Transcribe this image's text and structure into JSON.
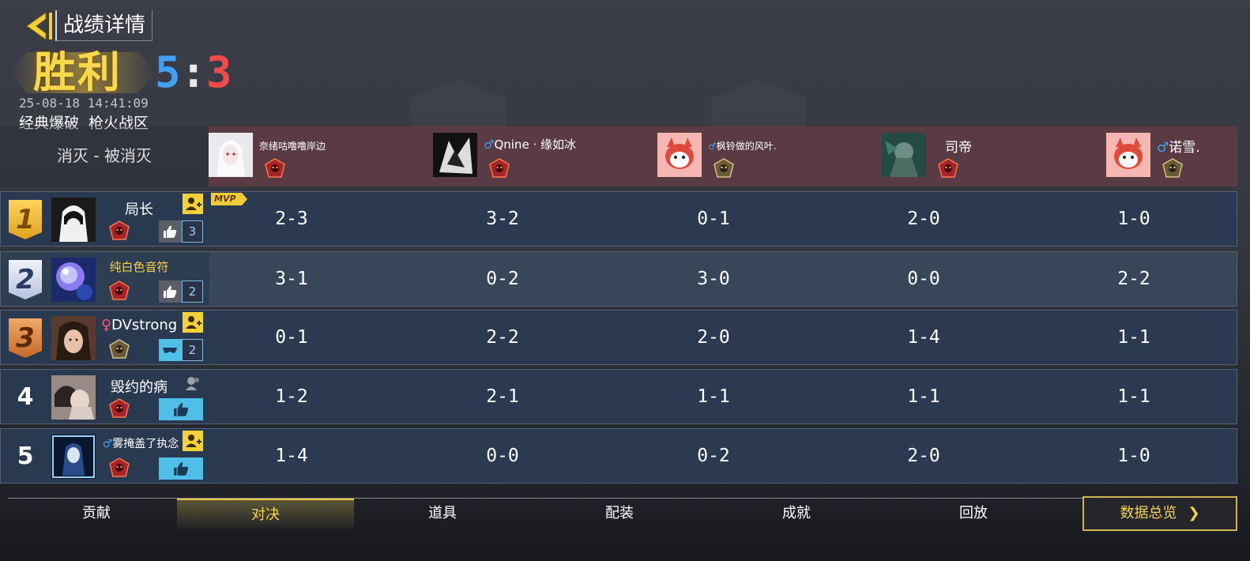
{
  "header": {
    "title": "战绩详情",
    "result": "胜利",
    "score_blue": "5",
    "score_sep": ":",
    "score_red": "3",
    "timestamp": "25-08-18 14:41:09",
    "mode": "经典爆破",
    "map": "枪火战区"
  },
  "axis_label": "消灭 - 被消灭",
  "mvp_label": "MVP",
  "opponents": [
    {
      "name": "奈绪咕噜噜岸边",
      "gender": ""
    },
    {
      "name": "Qnine · 缘如冰",
      "gender": "♂"
    },
    {
      "name": "枫铃做的风叶.",
      "gender": "♂"
    },
    {
      "name": "司帝",
      "gender": ""
    },
    {
      "name": "诺雪.",
      "gender": "♂"
    }
  ],
  "players": [
    {
      "place": "1",
      "name": "局长",
      "gender": "",
      "likes": "3",
      "results": [
        "2-3",
        "3-2",
        "0-1",
        "2-0",
        "1-0"
      ]
    },
    {
      "place": "2",
      "name": "纯白色音符",
      "gender": "",
      "likes": "2",
      "results": [
        "3-1",
        "0-2",
        "3-0",
        "0-0",
        "2-2"
      ]
    },
    {
      "place": "3",
      "name": "DVstrong",
      "gender": "♀",
      "likes": "2",
      "results": [
        "0-1",
        "2-2",
        "2-0",
        "1-4",
        "1-1"
      ]
    },
    {
      "place": "4",
      "name": "毁约的病",
      "gender": "",
      "likes": "",
      "results": [
        "1-2",
        "2-1",
        "1-1",
        "1-1",
        "1-1"
      ]
    },
    {
      "place": "5",
      "name": "雾掩盖了执念",
      "gender": "♂",
      "likes": "",
      "results": [
        "1-4",
        "0-0",
        "0-2",
        "2-0",
        "1-0"
      ]
    }
  ],
  "tabs": [
    "贡献",
    "对决",
    "道具",
    "配装",
    "成就",
    "回放"
  ],
  "active_tab": "对决",
  "overview_button": "数据总览",
  "colors": {
    "gold": "#f3d44a",
    "blue_team": "#3fa0f5",
    "red_team": "#f04a4a",
    "row": "#2b3a50",
    "opponent_header": "#5a3b43"
  }
}
